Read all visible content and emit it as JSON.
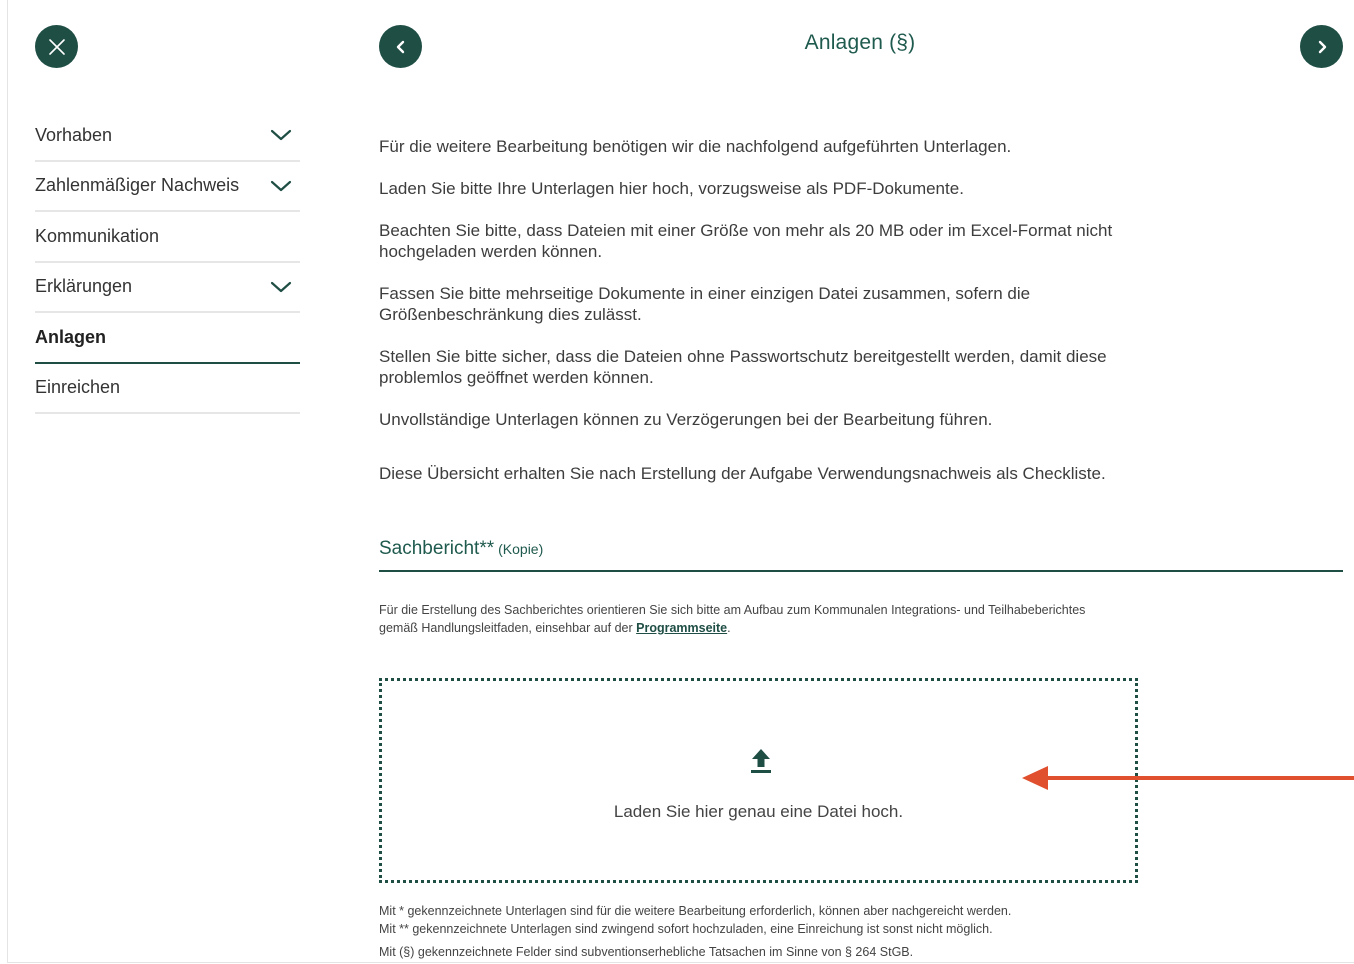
{
  "header": {
    "title": "Anlagen (§)"
  },
  "sidebar": {
    "items": [
      {
        "label": "Vorhaben",
        "expandable": true
      },
      {
        "label": "Zahlenmäßiger Nachweis",
        "expandable": true
      },
      {
        "label": "Kommunikation",
        "expandable": false
      },
      {
        "label": "Erklärungen",
        "expandable": true
      },
      {
        "label": "Anlagen",
        "expandable": false,
        "active": true
      },
      {
        "label": "Einreichen",
        "expandable": false
      }
    ]
  },
  "main": {
    "paragraphs": [
      "Für die weitere Bearbeitung benötigen wir die nachfolgend aufgeführten Unterlagen.",
      "Laden Sie bitte Ihre Unterlagen hier hoch, vorzugsweise als PDF-Dokumente.",
      "Beachten Sie bitte, dass Dateien mit einer Größe von mehr als 20 MB oder im Excel-Format nicht hochgeladen werden können.",
      "Fassen Sie bitte mehrseitige Dokumente in einer einzigen Datei zusammen, sofern die Größenbeschränkung dies zulässt.",
      "Stellen Sie bitte sicher, dass die Dateien ohne Passwortschutz bereitgestellt werden, damit diese problemlos geöffnet werden können.",
      "Unvollständige Unterlagen können zu Verzögerungen bei der Bearbeitung führen.",
      "Diese Übersicht erhalten Sie nach Erstellung der Aufgabe Verwendungsnachweis als Checkliste."
    ],
    "section": {
      "title": "Sachbericht**",
      "tag": "(Kopie)",
      "hint_before": "Für die Erstellung des Sachberichtes orientieren Sie sich bitte am Aufbau zum Kommunalen Integrations- und Teilhabeberichtes gemäß Handlungsleitfaden, einsehbar auf der ",
      "hint_link": "Programmseite",
      "hint_after": ".",
      "dropzone_text": "Laden Sie hier genau eine Datei hoch."
    },
    "footnotes": [
      "Mit * gekennzeichnete Unterlagen sind für die weitere Bearbeitung erforderlich, können aber nachgereicht werden.",
      "Mit ** gekennzeichnete Unterlagen sind zwingend sofort hochzuladen, eine Einreichung ist sonst nicht möglich.",
      "Mit (§) gekennzeichnete Felder sind subventionserhebliche Tatsachen im Sinne von § 264 StGB."
    ]
  },
  "colors": {
    "brand": "#1f4e45",
    "annotation_arrow": "#e0502e"
  },
  "icons": {
    "close": "close-icon",
    "prev": "chevron-left-icon",
    "next": "chevron-right-icon",
    "expand": "chevron-down-icon",
    "upload": "upload-icon"
  }
}
